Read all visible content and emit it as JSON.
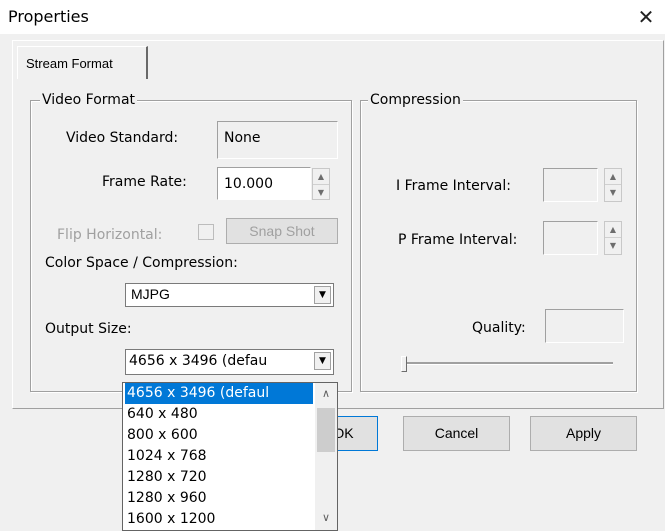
{
  "window": {
    "title": "Properties",
    "close_glyph": "✕"
  },
  "tabs": [
    {
      "label": "Stream Format"
    }
  ],
  "video_format": {
    "title": "Video Format",
    "video_standard_label": "Video Standard:",
    "video_standard_value": "None",
    "frame_rate_label": "Frame Rate:",
    "frame_rate_value": "10.000",
    "flip_horizontal_label": "Flip Horizontal:",
    "snap_shot_label": "Snap Shot",
    "color_space_label": "Color Space / Compression:",
    "color_space_value": "MJPG",
    "output_size_label": "Output Size:",
    "output_size_value": "4656 x 3496  (defau"
  },
  "compression": {
    "title": "Compression",
    "i_frame_label": "I Frame Interval:",
    "p_frame_label": "P Frame Interval:",
    "quality_label": "Quality:"
  },
  "output_size_options": [
    {
      "label": "4656 x 3496  (defaul",
      "selected": true
    },
    {
      "label": "640 x 480"
    },
    {
      "label": "800 x 600"
    },
    {
      "label": "1024 x 768"
    },
    {
      "label": "1280 x 720"
    },
    {
      "label": "1280 x 960"
    },
    {
      "label": "1600 x 1200"
    }
  ],
  "buttons": {
    "ok": "OK",
    "cancel": "Cancel",
    "apply": "Apply"
  },
  "colors": {
    "selection": "#0078d7",
    "dialog_bg": "#f0f0f0"
  },
  "icons": {
    "close": "close-icon",
    "dropdown": "chevron-down-icon",
    "spin": "spin-arrows"
  }
}
